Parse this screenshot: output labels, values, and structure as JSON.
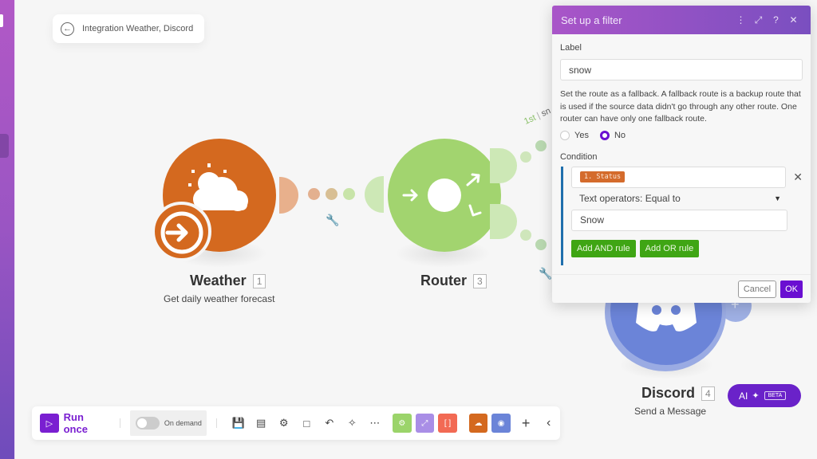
{
  "breadcrumb": {
    "back_icon": "arrow-left-circle-icon",
    "title": "Integration Weather, Discord"
  },
  "nodes": [
    {
      "id": 1,
      "name": "Weather",
      "number": "1",
      "subtitle": "Get daily weather forecast",
      "color": "#d4691f",
      "icon": "sun-cloud-icon",
      "trigger_icon": "arrow-right-icon"
    },
    {
      "id": 3,
      "name": "Router",
      "number": "3",
      "subtitle": "",
      "color": "#9fd46e",
      "icon": "router-icon"
    },
    {
      "id": 4,
      "name": "Discord",
      "number": "4",
      "subtitle": "Send a Message",
      "color": "#6b84d8",
      "icon": "discord-icon"
    }
  ],
  "route_label": {
    "order": "1st",
    "partial": "sn"
  },
  "filter_panel": {
    "title": "Set up a filter",
    "header_icons": [
      "more-vertical-icon",
      "expand-icon",
      "help-icon",
      "close-icon"
    ],
    "label_caption": "Label",
    "label_value": "snow",
    "fallback_help": "Set the route as a fallback. A fallback route is a backup route that is used if the source data didn't go through any other route. One router can have only one fallback route.",
    "fallback_options": [
      {
        "label": "Yes",
        "selected": false
      },
      {
        "label": "No",
        "selected": true
      }
    ],
    "condition_caption": "Condition",
    "condition": {
      "field_tag": "1. Status",
      "operator": "Text operators: Equal to",
      "value": "Snow"
    },
    "add_and_label": "Add AND rule",
    "add_or_label": "Add OR rule",
    "cancel_label": "Cancel",
    "ok_label": "OK",
    "accent": "#6a0fd1"
  },
  "ai_button": {
    "label": "AI",
    "badge": "BETA"
  },
  "toolbar": {
    "run_label": "Run once",
    "schedule_label": "On demand",
    "schedule_enabled": false,
    "tools": [
      "save-icon",
      "auto-align-icon",
      "settings-icon",
      "notes-icon",
      "undo-icon",
      "magic-wand-icon",
      "more-icon"
    ],
    "modules": [
      {
        "name": "tools-module",
        "color": "#9bd46a"
      },
      {
        "name": "flow-control-module",
        "color": "#a98ee6"
      },
      {
        "name": "text-parser-module",
        "color": "#f26a54"
      },
      {
        "name": "weather-module",
        "color": "#d4691f"
      },
      {
        "name": "discord-module",
        "color": "#6b84d8"
      }
    ],
    "add_icon": "plus-icon",
    "collapse_icon": "chevron-left-icon"
  }
}
